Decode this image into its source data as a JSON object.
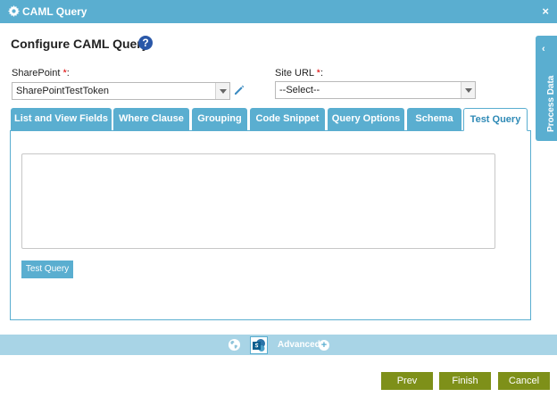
{
  "window": {
    "title": "CAML Query",
    "close_label": "×"
  },
  "page": {
    "title": "Configure CAML Query",
    "help_label": "?"
  },
  "sharepoint": {
    "label": "SharePoint ",
    "required": "*",
    "colon": ":",
    "value": "SharePointTestToken"
  },
  "site_url": {
    "label": "Site URL ",
    "required": "*",
    "colon": ":",
    "value": "--Select--"
  },
  "process_data": {
    "label": "Process Data",
    "chevron": "‹"
  },
  "tabs": [
    {
      "label": "List and View Fields"
    },
    {
      "label": "Where Clause"
    },
    {
      "label": "Grouping"
    },
    {
      "label": "Code Snippet"
    },
    {
      "label": "Query Options"
    },
    {
      "label": "Schema"
    },
    {
      "label": "Test Query"
    }
  ],
  "test_query": {
    "value": "",
    "button_label": "Test Query"
  },
  "advanced": {
    "label": "Advanced",
    "plus": "+"
  },
  "footer": {
    "prev_label": "Prev",
    "finish_label": "Finish",
    "cancel_label": "Cancel"
  },
  "colors": {
    "accent": "#5aaed0",
    "footer_button": "#7e9019",
    "help": "#2a58a8",
    "required": "#dd0000"
  }
}
